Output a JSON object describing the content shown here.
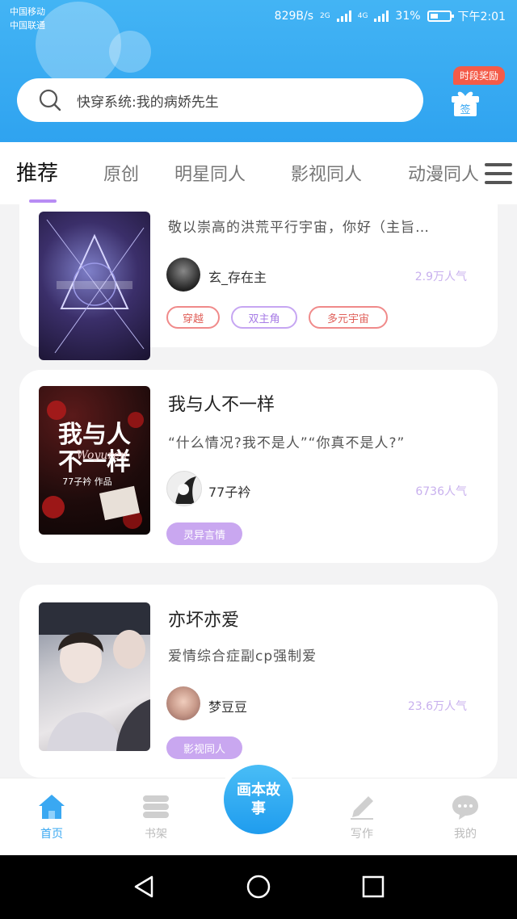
{
  "status_bar": {
    "carrier1": "中国移动",
    "carrier2": "中国联通",
    "net_speed": "829B/s",
    "signal1": "2G",
    "signal2": "4G",
    "battery": "31%",
    "time": "下午2:01"
  },
  "search": {
    "placeholder": "快穿系统:我的病娇先生"
  },
  "checkin": {
    "badge": "时段奖励",
    "label": "签"
  },
  "tabs": [
    {
      "label": "推荐"
    },
    {
      "label": "原创"
    },
    {
      "label": "明星同人"
    },
    {
      "label": "影视同人"
    },
    {
      "label": "动漫同人"
    }
  ],
  "books": [
    {
      "title": "",
      "desc": "敬以崇高的洪荒平行宇宙，你好（主旨…",
      "author": "玄_存在主",
      "popularity": "2.9万人气",
      "tags": [
        "穿越",
        "双主角",
        "多元宇宙"
      ]
    },
    {
      "title": "我与人不一样",
      "desc": "“什么情况?我不是人”“你真不是人?”",
      "author": "77子衿",
      "popularity": "6736人气",
      "tags": [
        "灵异言情"
      ],
      "cover_text": "我与人不一样",
      "cover_sub": "Woyuren",
      "cover_author": "77子衿 作品"
    },
    {
      "title": "亦坏亦爱",
      "desc": "爱情综合症副cp强制爱",
      "author": "梦豆豆",
      "popularity": "23.6万人气",
      "tags": [
        "影视同人"
      ]
    }
  ],
  "bottom_nav": {
    "home": "首页",
    "shelf": "书架",
    "center": "画本故事",
    "write": "写作",
    "mine": "我的"
  },
  "colors": {
    "header_blue": "#3aa8f2",
    "tab_accent": "#b88cf4",
    "tag_purple": "#c9a7f0",
    "tag_red": "#e0605a"
  }
}
